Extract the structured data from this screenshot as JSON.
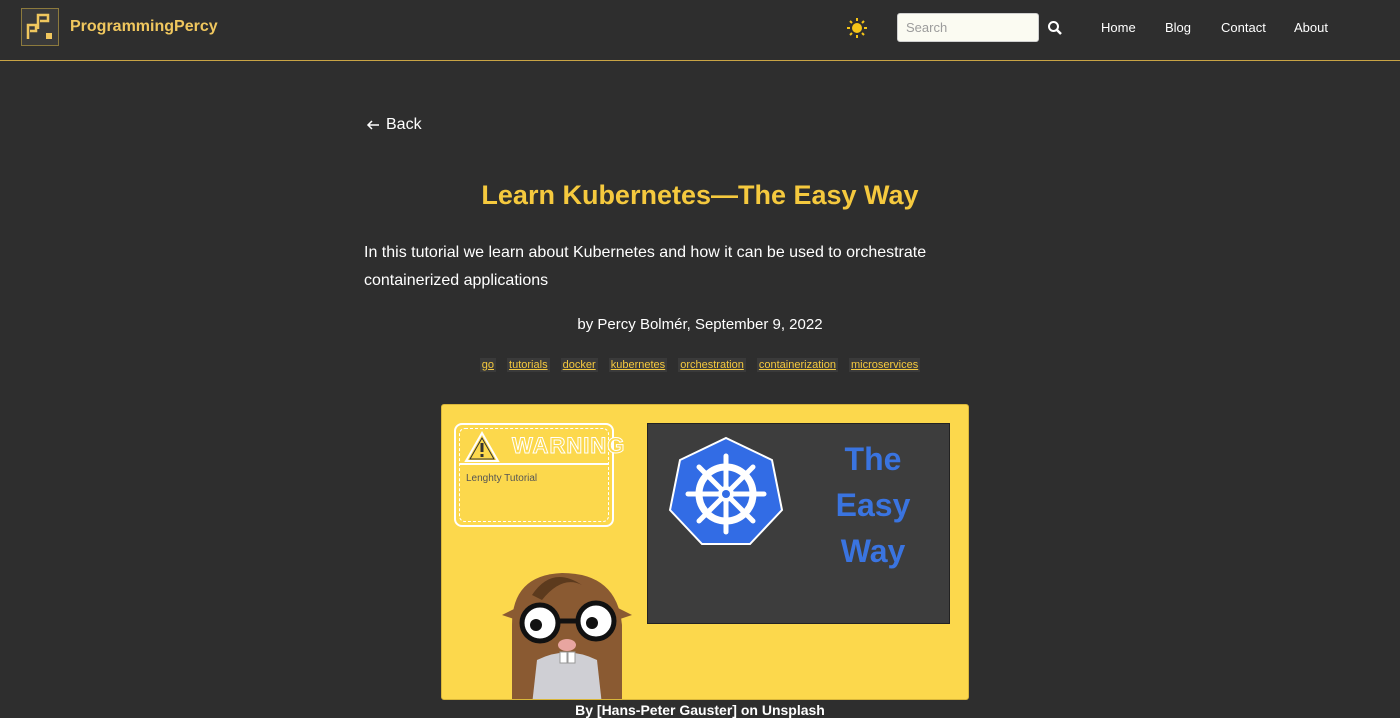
{
  "header": {
    "brand": "ProgrammingPercy",
    "search_placeholder": "Search",
    "nav": [
      "Home",
      "Blog",
      "Contact",
      "About"
    ]
  },
  "content": {
    "back_label": "Back",
    "title": "Learn Kubernetes—The Easy Way",
    "lead": "In this tutorial we learn about Kubernetes and how it can be used to orchestrate containerized applications",
    "byline": "by Percy Bolmér, September 9, 2022",
    "tags": [
      "go",
      "tutorials",
      "docker",
      "kubernetes",
      "orchestration",
      "containerization",
      "microservices"
    ]
  },
  "hero": {
    "warning_label": "WARNING",
    "warning_sub": "Lenghty Tutorial",
    "easy_line1": "The",
    "easy_line2": "Easy",
    "easy_line3": "Way",
    "caption": "By [Hans-Peter Gauster] on Unsplash"
  },
  "colors": {
    "accent": "#f5c93e",
    "background": "#2e2e2e",
    "hero_bg": "#fcd84c",
    "k8s_blue": "#326ce5"
  }
}
